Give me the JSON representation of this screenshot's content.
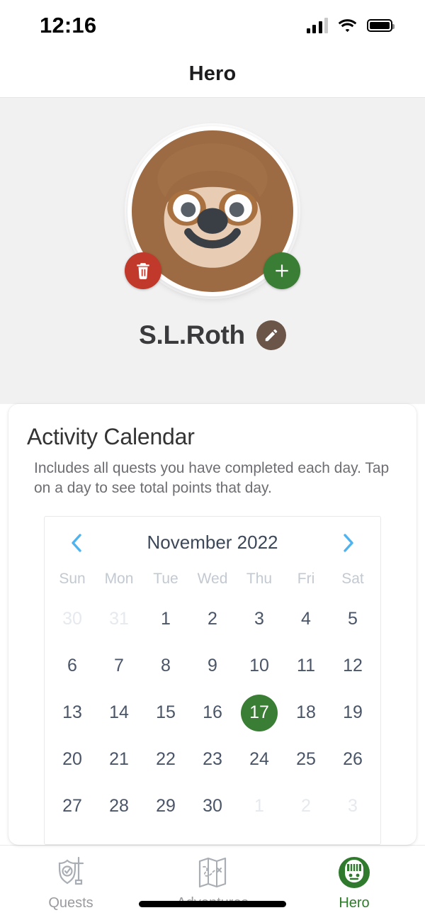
{
  "status_bar": {
    "time": "12:16",
    "signal_icon": "cellular-signal-icon",
    "wifi_icon": "wifi-icon",
    "battery_icon": "battery-full-icon"
  },
  "navbar": {
    "title": "Hero"
  },
  "profile": {
    "avatar_icon": "sloth-avatar",
    "delete_button_icon": "trash-icon",
    "add_button_icon": "plus-icon",
    "name": "S.L.Roth",
    "edit_button_icon": "pencil-icon"
  },
  "card": {
    "title": "Activity Calendar",
    "subtitle": "Includes all quests you have completed each day. Tap on a day to see total points that day."
  },
  "calendar": {
    "month_label": "November 2022",
    "prev_icon": "chevron-left-icon",
    "next_icon": "chevron-right-icon",
    "accent_color": "#3a7d34",
    "nav_color": "#4fb3f0",
    "day_headers": [
      "Sun",
      "Mon",
      "Tue",
      "Wed",
      "Thu",
      "Fri",
      "Sat"
    ],
    "selected_day": 17,
    "weeks": [
      [
        {
          "n": "30",
          "muted": true
        },
        {
          "n": "31",
          "muted": true
        },
        {
          "n": "1"
        },
        {
          "n": "2"
        },
        {
          "n": "3"
        },
        {
          "n": "4"
        },
        {
          "n": "5"
        }
      ],
      [
        {
          "n": "6"
        },
        {
          "n": "7"
        },
        {
          "n": "8"
        },
        {
          "n": "9"
        },
        {
          "n": "10"
        },
        {
          "n": "11"
        },
        {
          "n": "12"
        }
      ],
      [
        {
          "n": "13"
        },
        {
          "n": "14"
        },
        {
          "n": "15"
        },
        {
          "n": "16"
        },
        {
          "n": "17",
          "selected": true
        },
        {
          "n": "18"
        },
        {
          "n": "19"
        }
      ],
      [
        {
          "n": "20"
        },
        {
          "n": "21"
        },
        {
          "n": "22"
        },
        {
          "n": "23"
        },
        {
          "n": "24"
        },
        {
          "n": "25"
        },
        {
          "n": "26"
        }
      ],
      [
        {
          "n": "27"
        },
        {
          "n": "28"
        },
        {
          "n": "29"
        },
        {
          "n": "30"
        },
        {
          "n": "1",
          "muted": true
        },
        {
          "n": "2",
          "muted": true
        },
        {
          "n": "3",
          "muted": true
        }
      ]
    ]
  },
  "tabbar": {
    "items": [
      {
        "label": "Quests",
        "icon": "shield-sword-icon",
        "active": false
      },
      {
        "label": "Adventures",
        "icon": "treasure-map-icon",
        "active": false
      },
      {
        "label": "Hero",
        "icon": "knight-helmet-icon",
        "active": true
      }
    ]
  }
}
